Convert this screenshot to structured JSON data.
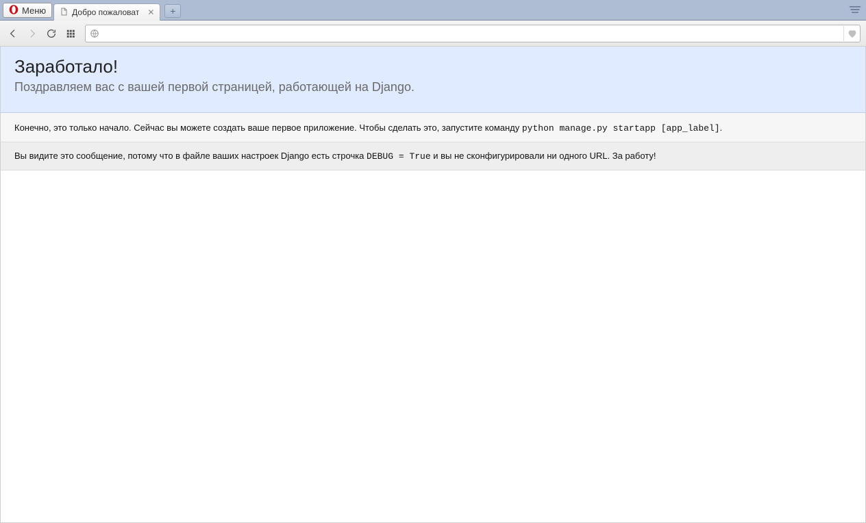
{
  "browser": {
    "menu_label": "Меню",
    "tab_title": "Добро пожаловат",
    "url_value": "",
    "url_blurred": " "
  },
  "page": {
    "heading": "Заработало!",
    "subheading": "Поздравляем вас с вашей первой страницей, работающей на Django.",
    "instructions_pre": "Конечно, это только начало. Сейчас вы можете создать ваше первое приложение. Чтобы сделать это, запустите команду ",
    "instructions_code": "python manage.py startapp [app_label]",
    "instructions_post": ".",
    "explanation_pre": "Вы видите это сообщение, потому что в файле ваших настроек Django есть строчка ",
    "explanation_code": "DEBUG = True",
    "explanation_post": " и вы не сконфигурировали ни одного URL. За работу!"
  }
}
